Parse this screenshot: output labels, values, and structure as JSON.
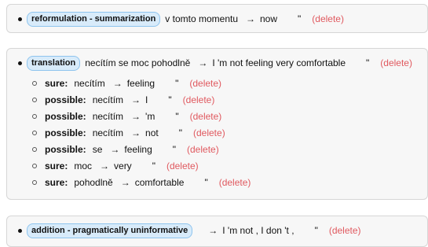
{
  "arrow": "→",
  "quote": "\"",
  "delete_label": "(delete)",
  "items": [
    {
      "tag": "reformulation - summarization",
      "source": "v tomto momentu",
      "target": "now"
    },
    {
      "tag": "translation",
      "source": "necítím se moc pohodlně",
      "target": "I 'm not feeling very comfortable",
      "alignments": [
        {
          "kind": "sure:",
          "source": "necítím",
          "target": "feeling"
        },
        {
          "kind": "possible:",
          "source": "necítím",
          "target": "I"
        },
        {
          "kind": "possible:",
          "source": "necítím",
          "target": "'m"
        },
        {
          "kind": "possible:",
          "source": "necítím",
          "target": "not"
        },
        {
          "kind": "possible:",
          "source": "se",
          "target": "feeling"
        },
        {
          "kind": "sure:",
          "source": "moc",
          "target": "very"
        },
        {
          "kind": "sure:",
          "source": "pohodlně",
          "target": "comfortable"
        }
      ]
    },
    {
      "tag": "addition - pragmatically uninformative",
      "source": "",
      "target": "I 'm not , I don 't ,"
    }
  ]
}
